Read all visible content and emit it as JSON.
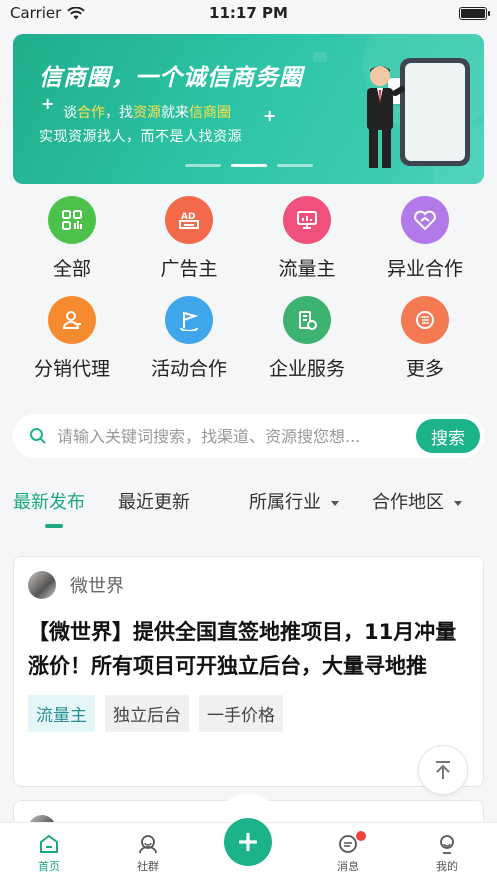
{
  "status_bar": {
    "carrier": "Carrier",
    "time": "11:17 PM"
  },
  "banner": {
    "title": "信商圈，一个诚信商务圈",
    "line2_parts": [
      "谈",
      "合作",
      "，找",
      "资源",
      "就来",
      "信商圈"
    ],
    "line3": "实现资源找人，而不是人找资源"
  },
  "categories": [
    {
      "label": "全部",
      "icon": "grid-icon",
      "color": "#4cc24a"
    },
    {
      "label": "广告主",
      "icon": "ad-icon",
      "color": "#f26a4a"
    },
    {
      "label": "流量主",
      "icon": "monitor-icon",
      "color": "#f0507a"
    },
    {
      "label": "异业合作",
      "icon": "handshake-heart-icon",
      "color": "#b27ae8"
    },
    {
      "label": "分销代理",
      "icon": "agent-icon",
      "color": "#f58a2e"
    },
    {
      "label": "活动合作",
      "icon": "flag-icon",
      "color": "#3fa6ea"
    },
    {
      "label": "企业服务",
      "icon": "building-icon",
      "color": "#3db372"
    },
    {
      "label": "更多",
      "icon": "more-icon",
      "color": "#f47a54"
    }
  ],
  "search": {
    "placeholder": "请输入关键词搜索，找渠道、资源搜您想...",
    "button": "搜索"
  },
  "tabs": {
    "latest": "最新发布",
    "recent": "最近更新",
    "industry": "所属行业",
    "region": "合作地区"
  },
  "posts": [
    {
      "author": "微世界",
      "title": "【微世界】提供全国直签地推项目，11月冲量涨价！所有项目可开独立后台，大量寻地推",
      "tags": [
        "流量主",
        "独立后台",
        "一手价格"
      ]
    }
  ],
  "tabbar": {
    "home": "首页",
    "community": "社群",
    "messages": "消息",
    "mine": "我的"
  },
  "colors": {
    "brand": "#1db38a",
    "badge": "#f04040"
  }
}
